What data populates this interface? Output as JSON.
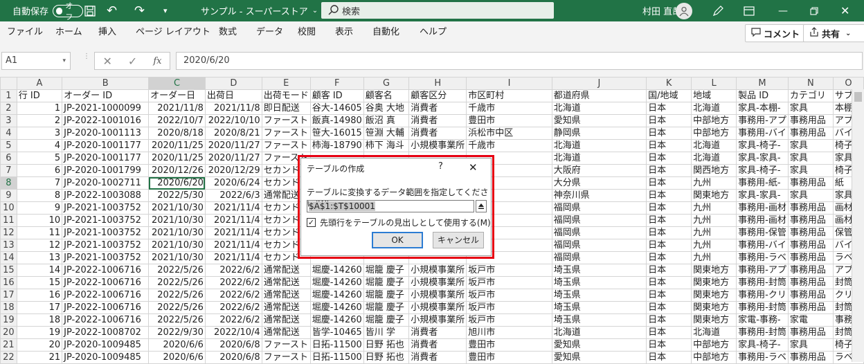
{
  "titlebar": {
    "autosave_label": "自動保存",
    "autosave_state": "オフ",
    "doc_title": "サンプル - スーパーストア",
    "search_placeholder": "検索",
    "user_name": "村田 直哉"
  },
  "menu": [
    "ファイル",
    "ホーム",
    "挿入",
    "ページ レイアウト",
    "数式",
    "データ",
    "校閲",
    "表示",
    "自動化",
    "ヘルプ"
  ],
  "comment_label": "コメント",
  "share_label": "共有",
  "formula": {
    "cell_ref": "A1",
    "fx_label": "fx",
    "value": "2020/6/20"
  },
  "sheet": {
    "col_headers": [
      "A",
      "B",
      "C",
      "D",
      "E",
      "F",
      "G",
      "H",
      "I",
      "J",
      "K",
      "L",
      "M",
      "N",
      "O"
    ],
    "rows": [
      [
        "1",
        "行 ID",
        "オーダー ID",
        "オーダー日",
        "出荷日",
        "出荷モード",
        "顧客 ID",
        "顧客名",
        "顧客区分",
        "市区町村",
        "都道府県",
        "国/地域",
        "地域",
        "製品 ID",
        "カテゴリ",
        "サブカ"
      ],
      [
        "2",
        "1",
        "JP-2021-1000099",
        "2021/11/8",
        "2021/11/8",
        "即日配送",
        "谷大-14605",
        "谷奥 大地",
        "消費者",
        "千歳市",
        "北海道",
        "日本",
        "北海道",
        "家具-本棚-",
        "家具",
        "本棚"
      ],
      [
        "3",
        "2",
        "JP-2022-1001016",
        "2022/10/7",
        "2022/10/10",
        "ファースト",
        "飯真-14980",
        "飯沼 真",
        "消費者",
        "豊田市",
        "愛知県",
        "日本",
        "中部地方",
        "事務用-アプ",
        "事務用品",
        "アプラ"
      ],
      [
        "4",
        "3",
        "JP-2020-1001113",
        "2020/8/18",
        "2020/8/21",
        "ファースト",
        "笹大-16015",
        "笹淵 大輔",
        "消費者",
        "浜松市中区",
        "静岡県",
        "日本",
        "中部地方",
        "事務用-バイ",
        "事務用品",
        "バイン"
      ],
      [
        "5",
        "4",
        "JP-2020-1001177",
        "2020/11/25",
        "2020/11/27",
        "ファースト",
        "柿海-18790",
        "柿下 海斗",
        "小規模事業所",
        "千歳市",
        "北海道",
        "日本",
        "北海道",
        "家具-椅子-",
        "家具",
        "椅子"
      ],
      [
        "6",
        "5",
        "JP-2020-1001177",
        "2020/11/25",
        "2020/11/27",
        "ファースト",
        "",
        "",
        "",
        "",
        "北海道",
        "日本",
        "北海道",
        "家具-家具-",
        "家具",
        "家具"
      ],
      [
        "7",
        "6",
        "JP-2020-1001799",
        "2020/12/26",
        "2020/12/29",
        "セカンド",
        "",
        "",
        "",
        "",
        "大阪府",
        "日本",
        "関西地方",
        "家具-椅子-",
        "家具",
        "椅子"
      ],
      [
        "8",
        "7",
        "JP-2020-1002711",
        "2020/6/20",
        "2020/6/24",
        "セカンド",
        "",
        "",
        "",
        "",
        "大分県",
        "日本",
        "九州",
        "事務用-紙-",
        "事務用品",
        "紙"
      ],
      [
        "9",
        "8",
        "JP-2022-1003088",
        "2022/5/30",
        "2022/6/3",
        "通常配送",
        "",
        "",
        "",
        "",
        "神奈川県",
        "日本",
        "関東地方",
        "家具-家具-",
        "家具",
        "家具"
      ],
      [
        "10",
        "9",
        "JP-2021-1003752",
        "2021/10/30",
        "2021/11/4",
        "セカンド",
        "",
        "",
        "",
        "",
        "福岡県",
        "日本",
        "九州",
        "事務用-画材",
        "事務用品",
        "画材"
      ],
      [
        "11",
        "10",
        "JP-2021-1003752",
        "2021/10/30",
        "2021/11/4",
        "セカンド",
        "",
        "",
        "",
        "",
        "福岡県",
        "日本",
        "九州",
        "事務用-画材",
        "事務用品",
        "画材"
      ],
      [
        "12",
        "11",
        "JP-2021-1003752",
        "2021/10/30",
        "2021/11/4",
        "セカンド",
        "",
        "",
        "",
        "",
        "福岡県",
        "日本",
        "九州",
        "事務用-保管",
        "事務用品",
        "保管箱"
      ],
      [
        "13",
        "12",
        "JP-2021-1003752",
        "2021/10/30",
        "2021/11/4",
        "セカンド",
        "",
        "",
        "",
        "",
        "福岡県",
        "日本",
        "九州",
        "事務用-バイ",
        "事務用品",
        "バイン"
      ],
      [
        "14",
        "13",
        "JP-2021-1003752",
        "2021/10/30",
        "2021/11/4",
        "セカンド",
        "",
        "",
        "",
        "",
        "福岡県",
        "日本",
        "九州",
        "事務用-ラベ",
        "事務用品",
        "ラベル"
      ],
      [
        "15",
        "14",
        "JP-2022-1006716",
        "2022/5/26",
        "2022/6/2",
        "通常配送",
        "堀慶-14260",
        "堀籠 慶子",
        "小規模事業所",
        "坂戸市",
        "埼玉県",
        "日本",
        "関東地方",
        "事務用-アプ",
        "事務用品",
        "アプラ"
      ],
      [
        "16",
        "15",
        "JP-2022-1006716",
        "2022/5/26",
        "2022/6/2",
        "通常配送",
        "堀慶-14260",
        "堀籠 慶子",
        "小規模事業所",
        "坂戸市",
        "埼玉県",
        "日本",
        "関東地方",
        "事務用-封筒",
        "事務用品",
        "封筒"
      ],
      [
        "17",
        "16",
        "JP-2022-1006716",
        "2022/5/26",
        "2022/6/2",
        "通常配送",
        "堀慶-14260",
        "堀籠 慶子",
        "小規模事業所",
        "坂戸市",
        "埼玉県",
        "日本",
        "関東地方",
        "事務用-クリ",
        "事務用品",
        "クリッ"
      ],
      [
        "18",
        "17",
        "JP-2022-1006716",
        "2022/5/26",
        "2022/6/2",
        "通常配送",
        "堀慶-14260",
        "堀籠 慶子",
        "小規模事業所",
        "坂戸市",
        "埼玉県",
        "日本",
        "関東地方",
        "事務用-封筒",
        "事務用品",
        "封筒"
      ],
      [
        "19",
        "18",
        "JP-2022-1006716",
        "2022/5/26",
        "2022/6/2",
        "通常配送",
        "堀慶-14260",
        "堀籠 慶子",
        "小規模事業所",
        "坂戸市",
        "埼玉県",
        "日本",
        "関東地方",
        "家電-事務-",
        "家電",
        "事務機"
      ],
      [
        "20",
        "19",
        "JP-2022-1008702",
        "2022/9/30",
        "2022/10/4",
        "通常配送",
        "皆学-10465",
        "皆川 学",
        "消費者",
        "旭川市",
        "北海道",
        "日本",
        "北海道",
        "事務用-封筒",
        "事務用品",
        "封筒"
      ],
      [
        "21",
        "20",
        "JP-2020-1009485",
        "2020/6/6",
        "2020/6/8",
        "ファースト",
        "日拓-11500",
        "日野 拓也",
        "消費者",
        "豊田市",
        "愛知県",
        "日本",
        "中部地方",
        "家具-椅子-",
        "家具",
        "椅子"
      ],
      [
        "22",
        "21",
        "JP-2020-1009485",
        "2020/6/6",
        "2020/6/8",
        "ファースト",
        "日拓-11500",
        "日野 拓也",
        "消費者",
        "豊田市",
        "愛知県",
        "日本",
        "中部地方",
        "事務用-ラベ",
        "事務用品",
        "ラベル"
      ]
    ]
  },
  "dialog": {
    "title": "テーブルの作成",
    "help": "?",
    "prompt": "テーブルに変換するデータ範囲を指定してください(W)",
    "range": "$A$1:$T$10001",
    "header_checkbox_label": "先頭行をテーブルの見出しとして使用する(M)",
    "header_checked": true,
    "ok": "OK",
    "cancel": "キャンセル"
  }
}
